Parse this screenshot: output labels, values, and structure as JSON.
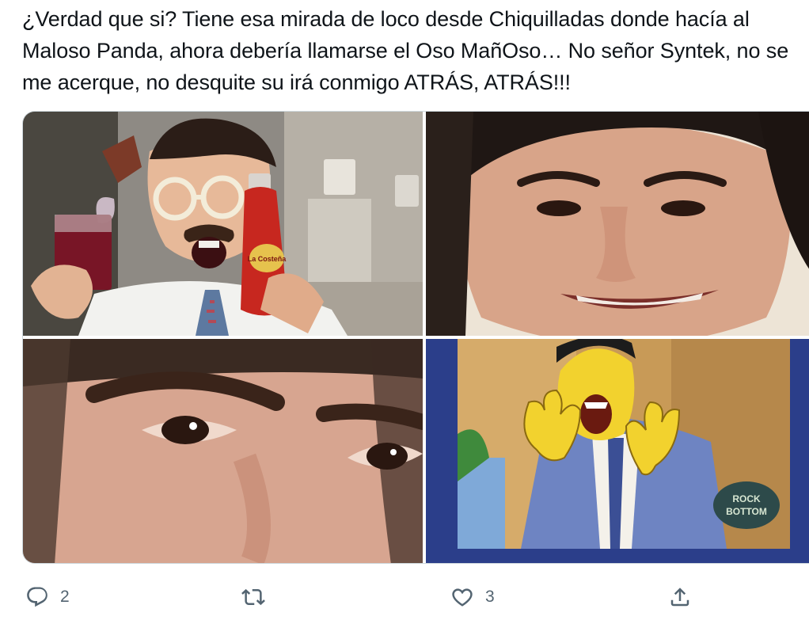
{
  "tweet": {
    "text": "¿Verdad que si? Tiene esa mirada de loco desde Chiquilladas donde hacía al Maloso Panda, ahora debería llamarse el Oso MañOso… No señor Syntek, no se me acerque, no desquite su irá conmigo ATRÁS, ATRÁS!!!"
  },
  "media": {
    "bottle_label": "La Costeña",
    "sign_line1": "ROCK",
    "sign_line2": "BOTTOM"
  },
  "actions": {
    "reply": {
      "icon": "reply-icon",
      "count": "2"
    },
    "retweet": {
      "icon": "retweet-icon",
      "count": ""
    },
    "like": {
      "icon": "heart-icon",
      "count": "3"
    },
    "share": {
      "icon": "share-icon",
      "count": ""
    }
  },
  "colors": {
    "text": "#0f1419",
    "secondary": "#536471",
    "border": "#cfd9de"
  }
}
